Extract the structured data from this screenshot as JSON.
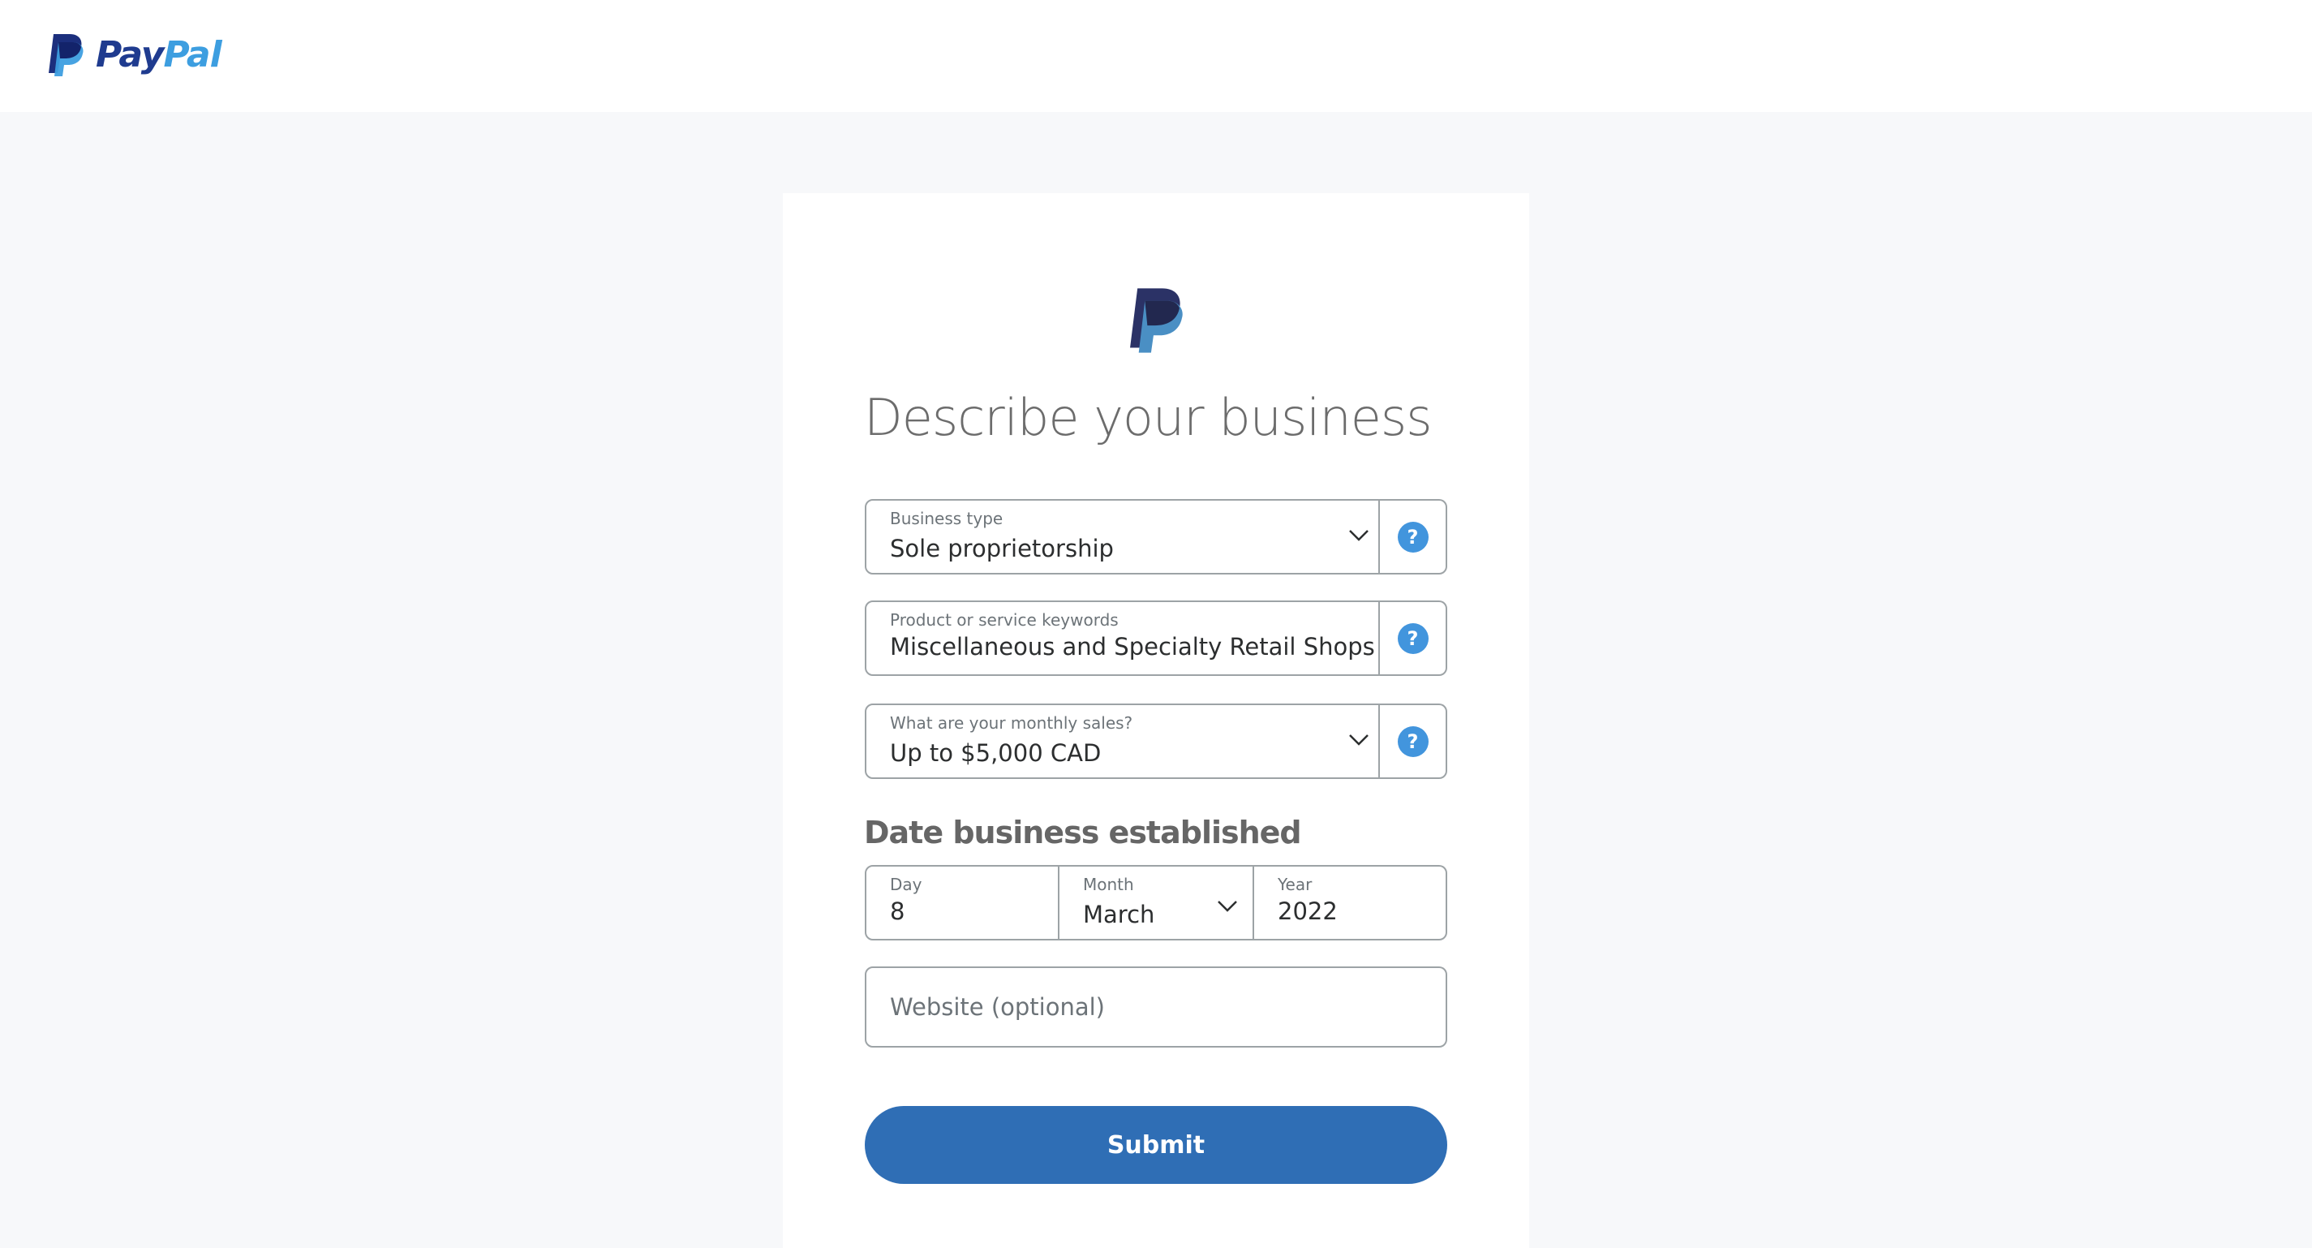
{
  "header": {
    "logo_icon": "paypal-monogram-icon",
    "wordmark_part1": "Pay",
    "wordmark_part2": "Pal"
  },
  "card": {
    "logo_icon": "paypal-monogram-icon",
    "title": "Describe your business"
  },
  "form": {
    "business_type": {
      "label": "Business type",
      "value": "Sole proprietorship",
      "help_icon": "?"
    },
    "keywords": {
      "label": "Product or service keywords",
      "value": "Miscellaneous and Specialty Retail Shops",
      "help_icon": "?"
    },
    "monthly_sales": {
      "label": "What are your monthly sales?",
      "value": "Up to $5,000 CAD",
      "help_icon": "?"
    },
    "date_section_title": "Date business established",
    "date": {
      "day_label": "Day",
      "day_value": "8",
      "month_label": "Month",
      "month_value": "March",
      "year_label": "Year",
      "year_value": "2022"
    },
    "website": {
      "placeholder": "Website (optional)",
      "value": ""
    },
    "submit_label": "Submit"
  },
  "colors": {
    "brand_dark": "#1f3b8f",
    "brand_light": "#3d9ee0",
    "button": "#2f6eb5",
    "help_icon": "#4295dd",
    "page_bg": "#f7f8fa"
  }
}
